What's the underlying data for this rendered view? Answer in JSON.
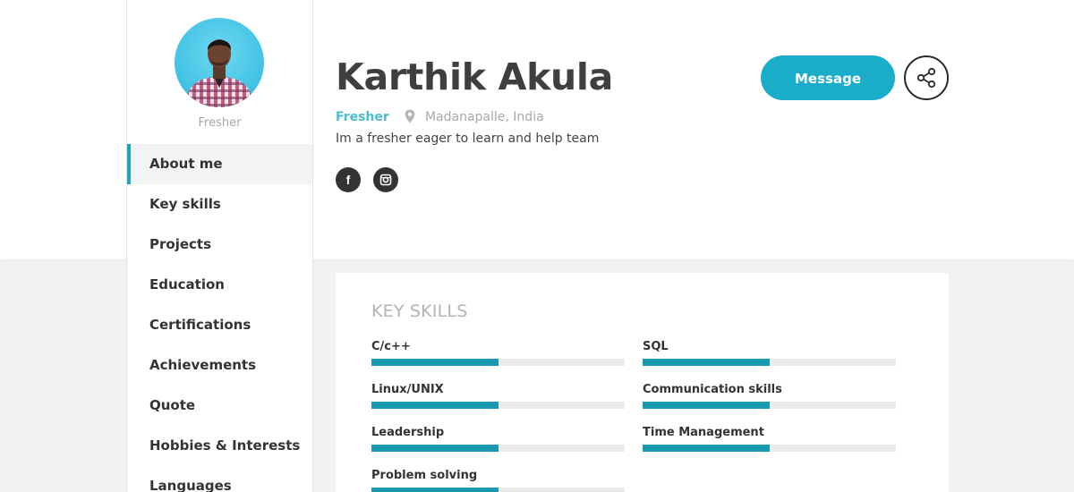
{
  "profile": {
    "name": "Karthik Akula",
    "level": "Fresher",
    "role": "Fresher",
    "location": "Madanapalle, India",
    "tagline": "Im a fresher eager to learn and help team",
    "avatar_icon": "profile-photo"
  },
  "actions": {
    "message_label": "Message",
    "share_icon": "share-icon"
  },
  "social": [
    {
      "icon": "facebook-icon",
      "glyph": "f"
    },
    {
      "icon": "instagram-icon"
    }
  ],
  "nav": {
    "items": [
      {
        "label": "About me",
        "active": true
      },
      {
        "label": "Key skills"
      },
      {
        "label": "Projects"
      },
      {
        "label": "Education"
      },
      {
        "label": "Certifications"
      },
      {
        "label": "Achievements"
      },
      {
        "label": "Quote"
      },
      {
        "label": "Hobbies & Interests"
      },
      {
        "label": "Languages"
      }
    ]
  },
  "skills_card": {
    "title": "KEY SKILLS",
    "skills": [
      {
        "name": "C/c++",
        "level": 0.5
      },
      {
        "name": "SQL",
        "level": 0.5
      },
      {
        "name": "Linux/UNIX",
        "level": 0.5
      },
      {
        "name": "Communication skills",
        "level": 0.5
      },
      {
        "name": "Leadership",
        "level": 0.5
      },
      {
        "name": "Time Management",
        "level": 0.5
      },
      {
        "name": "Problem solving",
        "level": 0.5
      }
    ]
  },
  "colors": {
    "accent": "#1aadca",
    "active_border": "#1aa6bb",
    "skill_bar": "#1a9aae",
    "role_text": "#4bbdd1"
  }
}
